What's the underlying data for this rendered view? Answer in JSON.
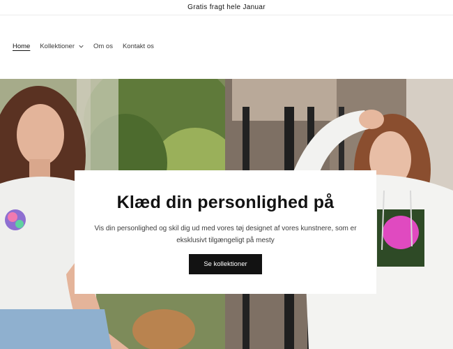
{
  "announcement": {
    "text": "Gratis fragt hele Januar"
  },
  "nav": {
    "items": [
      {
        "label": "Home",
        "active": true
      },
      {
        "label": "Kollektioner",
        "has_dropdown": true
      },
      {
        "label": "Om os"
      },
      {
        "label": "Kontakt os"
      }
    ]
  },
  "hero": {
    "title": "Klæd din personlighed på",
    "text": "Vis din personlighed og skil dig ud med vores tøj designet af vores kunstnere, som er eksklusivt tilgængeligt på mesty",
    "button_label": "Se kollektioner"
  },
  "colors": {
    "button_bg": "#121212",
    "text": "#121212",
    "background": "#ffffff"
  }
}
